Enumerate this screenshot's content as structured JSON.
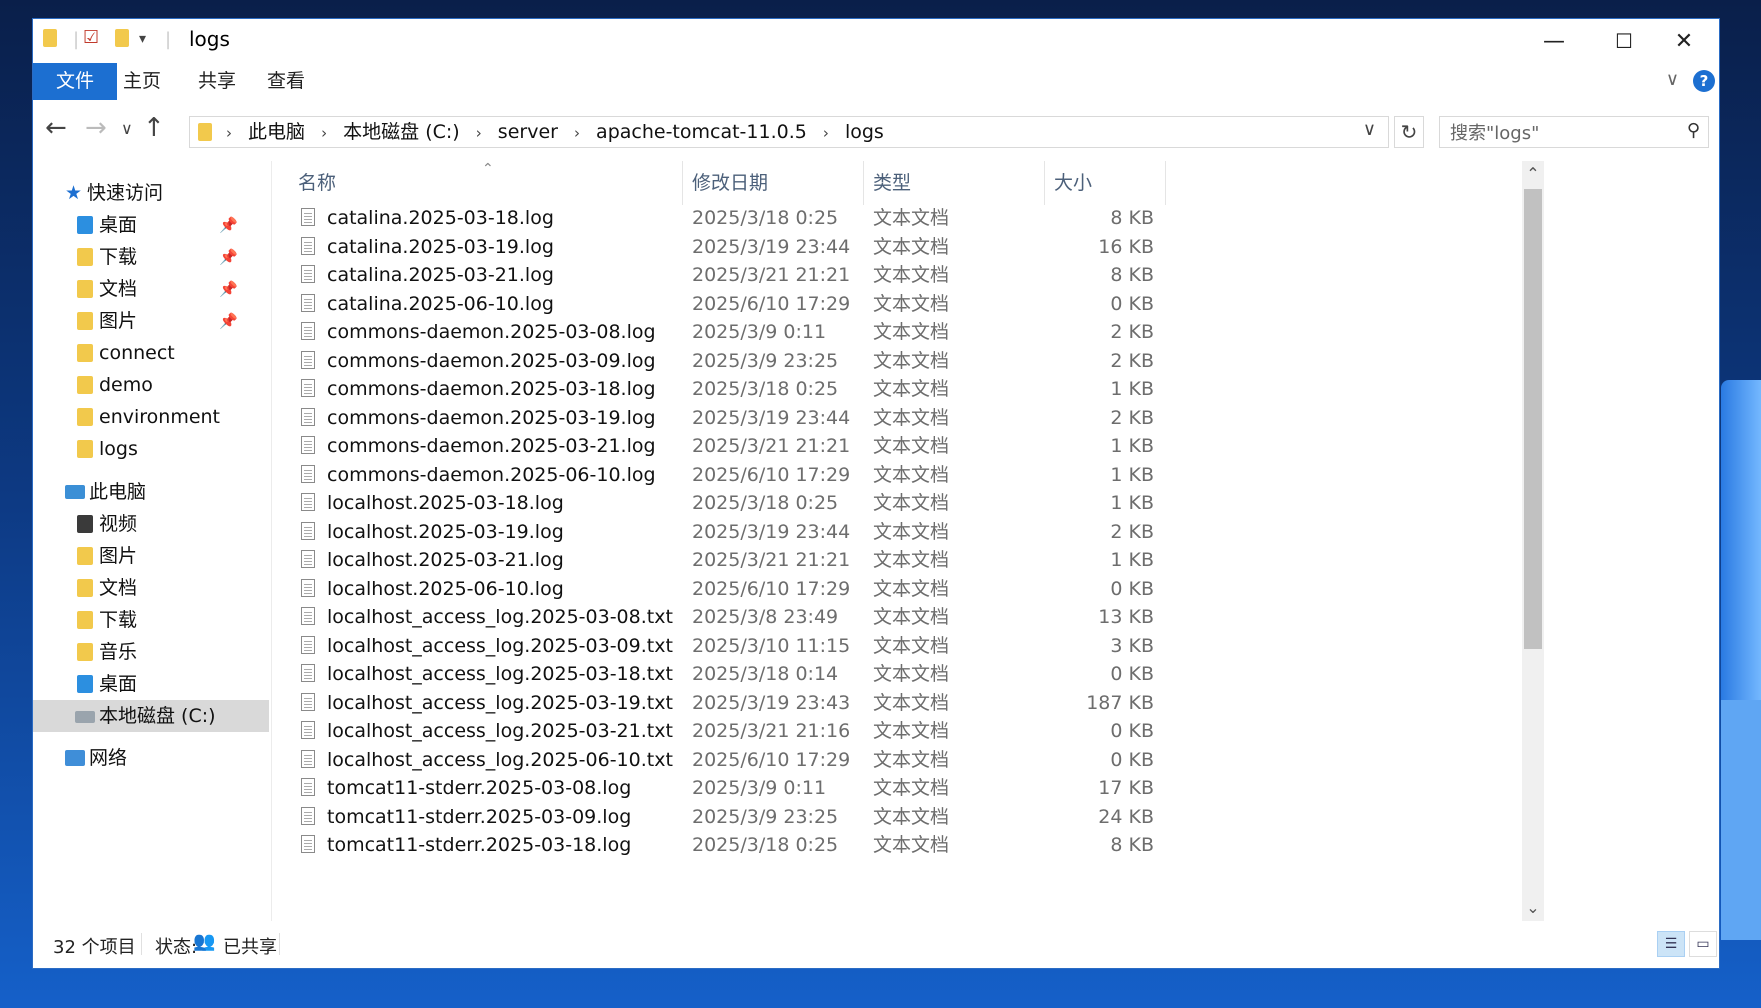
{
  "window": {
    "title": "logs",
    "minimize": "—",
    "maximize": "☐",
    "close": "✕"
  },
  "ribbon": {
    "tabs": [
      "文件",
      "主页",
      "共享",
      "查看"
    ],
    "help": "?"
  },
  "address": {
    "crumbs": [
      "此电脑",
      "本地磁盘 (C:)",
      "server",
      "apache-tomcat-11.0.5",
      "logs"
    ],
    "search_placeholder": "搜索\"logs\""
  },
  "sidebar": {
    "quick_access": "快速访问",
    "quick_items": [
      "桌面",
      "下载",
      "文档",
      "图片",
      "connect",
      "demo",
      "environment",
      "logs"
    ],
    "this_pc": "此电脑",
    "pc_items": [
      "视频",
      "图片",
      "文档",
      "下载",
      "音乐",
      "桌面",
      "本地磁盘 (C:)"
    ],
    "network": "网络",
    "selected": "本地磁盘 (C:)"
  },
  "columns": {
    "name": "名称",
    "date": "修改日期",
    "type": "类型",
    "size": "大小"
  },
  "files": [
    {
      "name": "catalina.2025-03-18.log",
      "date": "2025/3/18 0:25",
      "type": "文本文档",
      "size": "8 KB"
    },
    {
      "name": "catalina.2025-03-19.log",
      "date": "2025/3/19 23:44",
      "type": "文本文档",
      "size": "16 KB"
    },
    {
      "name": "catalina.2025-03-21.log",
      "date": "2025/3/21 21:21",
      "type": "文本文档",
      "size": "8 KB"
    },
    {
      "name": "catalina.2025-06-10.log",
      "date": "2025/6/10 17:29",
      "type": "文本文档",
      "size": "0 KB"
    },
    {
      "name": "commons-daemon.2025-03-08.log",
      "date": "2025/3/9 0:11",
      "type": "文本文档",
      "size": "2 KB"
    },
    {
      "name": "commons-daemon.2025-03-09.log",
      "date": "2025/3/9 23:25",
      "type": "文本文档",
      "size": "2 KB"
    },
    {
      "name": "commons-daemon.2025-03-18.log",
      "date": "2025/3/18 0:25",
      "type": "文本文档",
      "size": "1 KB"
    },
    {
      "name": "commons-daemon.2025-03-19.log",
      "date": "2025/3/19 23:44",
      "type": "文本文档",
      "size": "2 KB"
    },
    {
      "name": "commons-daemon.2025-03-21.log",
      "date": "2025/3/21 21:21",
      "type": "文本文档",
      "size": "1 KB"
    },
    {
      "name": "commons-daemon.2025-06-10.log",
      "date": "2025/6/10 17:29",
      "type": "文本文档",
      "size": "1 KB"
    },
    {
      "name": "localhost.2025-03-18.log",
      "date": "2025/3/18 0:25",
      "type": "文本文档",
      "size": "1 KB"
    },
    {
      "name": "localhost.2025-03-19.log",
      "date": "2025/3/19 23:44",
      "type": "文本文档",
      "size": "2 KB"
    },
    {
      "name": "localhost.2025-03-21.log",
      "date": "2025/3/21 21:21",
      "type": "文本文档",
      "size": "1 KB"
    },
    {
      "name": "localhost.2025-06-10.log",
      "date": "2025/6/10 17:29",
      "type": "文本文档",
      "size": "0 KB"
    },
    {
      "name": "localhost_access_log.2025-03-08.txt",
      "date": "2025/3/8 23:49",
      "type": "文本文档",
      "size": "13 KB"
    },
    {
      "name": "localhost_access_log.2025-03-09.txt",
      "date": "2025/3/10 11:15",
      "type": "文本文档",
      "size": "3 KB"
    },
    {
      "name": "localhost_access_log.2025-03-18.txt",
      "date": "2025/3/18 0:14",
      "type": "文本文档",
      "size": "0 KB"
    },
    {
      "name": "localhost_access_log.2025-03-19.txt",
      "date": "2025/3/19 23:43",
      "type": "文本文档",
      "size": "187 KB"
    },
    {
      "name": "localhost_access_log.2025-03-21.txt",
      "date": "2025/3/21 21:16",
      "type": "文本文档",
      "size": "0 KB"
    },
    {
      "name": "localhost_access_log.2025-06-10.txt",
      "date": "2025/6/10 17:29",
      "type": "文本文档",
      "size": "0 KB"
    },
    {
      "name": "tomcat11-stderr.2025-03-08.log",
      "date": "2025/3/9 0:11",
      "type": "文本文档",
      "size": "17 KB"
    },
    {
      "name": "tomcat11-stderr.2025-03-09.log",
      "date": "2025/3/9 23:25",
      "type": "文本文档",
      "size": "24 KB"
    },
    {
      "name": "tomcat11-stderr.2025-03-18.log",
      "date": "2025/3/18 0:25",
      "type": "文本文档",
      "size": "8 KB"
    }
  ],
  "status": {
    "count": "32 个项目",
    "state_label": "状态:",
    "state_value": "已共享"
  },
  "colors": {
    "accent": "#1c6fd1",
    "folder": "#f2c94c",
    "selected_bg": "#d9d9d9"
  }
}
